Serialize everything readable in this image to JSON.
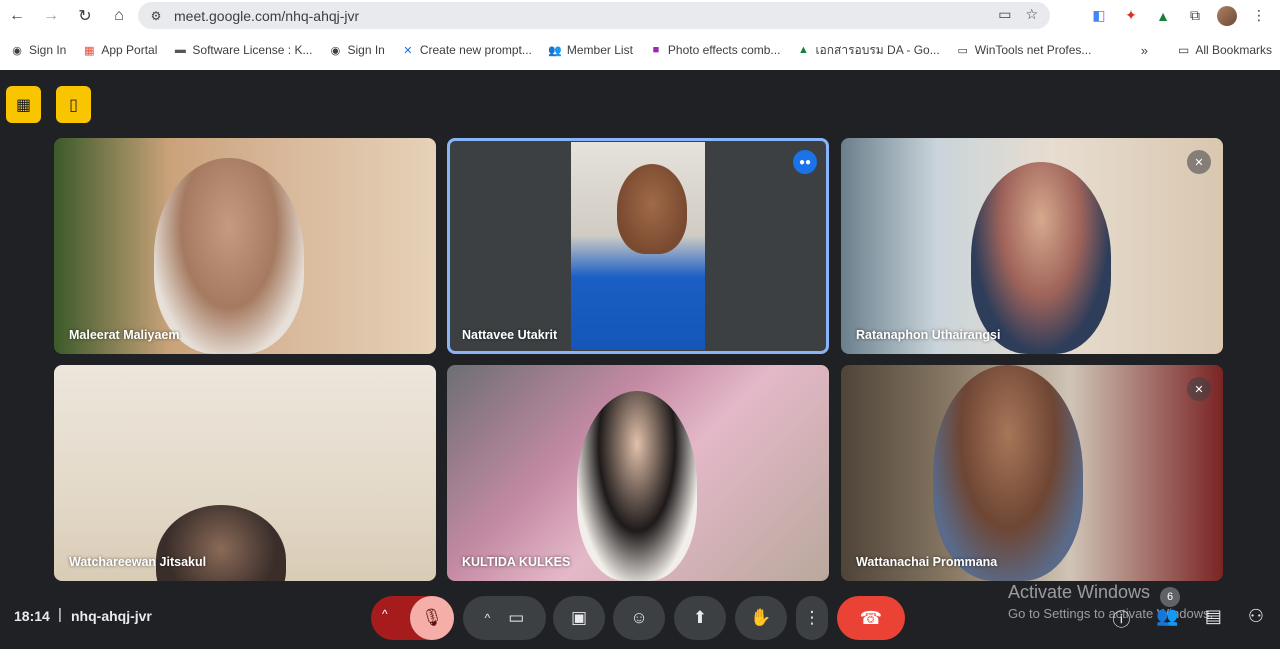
{
  "browser": {
    "url": "meet.google.com/nhq-ahqj-jvr",
    "bookmarks": [
      {
        "label": "Sign In",
        "icon": "globe-icon"
      },
      {
        "label": "App Portal",
        "icon": "apps-icon"
      },
      {
        "label": "Software License : K...",
        "icon": "license-icon"
      },
      {
        "label": "Sign In",
        "icon": "globe-icon"
      },
      {
        "label": "Create new prompt...",
        "icon": "prompt-icon"
      },
      {
        "label": "Member List",
        "icon": "people-icon"
      },
      {
        "label": "Photo effects comb...",
        "icon": "photo-icon"
      },
      {
        "label": "เอกสารอบรม DA - Go...",
        "icon": "drive-icon"
      },
      {
        "label": "WinTools net Profes...",
        "icon": "monitor-icon"
      }
    ],
    "more_label": "»",
    "all_bookmarks": "All Bookmarks"
  },
  "tiles": [
    {
      "name": "Maleerat Maliyaem",
      "mic": "none"
    },
    {
      "name": "Nattavee Utakrit",
      "mic": "speaking"
    },
    {
      "name": "Ratanaphon Uthairangsi",
      "mic": "muted"
    },
    {
      "name": "Watchareewan Jitsakul",
      "mic": "none"
    },
    {
      "name": "KULTIDA KULKES",
      "mic": "none"
    },
    {
      "name": "Wattanachai Prommana",
      "mic": "muted"
    }
  ],
  "bottom": {
    "time": "18:14",
    "separator": "|",
    "meeting_code": "nhq-ahqj-jvr",
    "people_count": "6"
  },
  "watermark": {
    "line1": "Activate Windows",
    "line2": "Go to Settings to activate Windows."
  }
}
